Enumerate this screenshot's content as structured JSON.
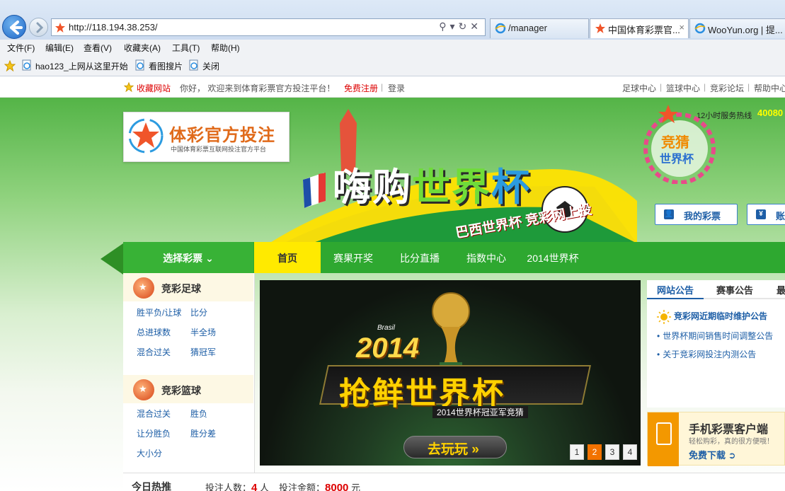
{
  "browser": {
    "address_url": "http://118.194.38.253/",
    "tabs": [
      {
        "label": "/manager"
      },
      {
        "label": "中国体育彩票官...",
        "close": "×"
      },
      {
        "label": "WooYun.org | 提..."
      }
    ],
    "menu": [
      "文件(F)",
      "编辑(E)",
      "查看(V)",
      "收藏夹(A)",
      "工具(T)",
      "帮助(H)"
    ],
    "favorites": [
      "hao123_上网从这里开始",
      "看图搜片",
      "关闭"
    ]
  },
  "topbar": {
    "bookmark": "收藏网站",
    "welcome": "你好， 欢迎来到体育彩票官方投注平台！",
    "register": "免费注册",
    "login": "登录",
    "links": [
      "足球中心",
      "篮球中心",
      "竞彩论坛",
      "帮助中心"
    ]
  },
  "logo": {
    "title": "体彩官方投注",
    "subtitle": "中国体育彩票互联网投注官方平台"
  },
  "banner": {
    "slogan": "巴西世界杯 竞彩网上投",
    "main_a": "嗨购",
    "main_b": "世界",
    "main_c": "杯"
  },
  "hotline": {
    "label": "12小时服务热线",
    "number": "40080"
  },
  "account": {
    "my_tickets": "我的彩票",
    "account": "账",
    "account_icon": "¥"
  },
  "nav": {
    "select": "选择彩票 ⌄",
    "tabs": [
      "首页",
      "赛果开奖",
      "比分直播",
      "指数中心",
      "2014世界杯"
    ]
  },
  "sidebar": {
    "football": {
      "title": "竞彩足球",
      "links": [
        "胜平负/让球",
        "比分",
        "总进球数",
        "半全场",
        "混合过关",
        "猜冠军"
      ]
    },
    "basketball": {
      "title": "竞彩篮球",
      "links": [
        "混合过关",
        "胜负",
        "让分胜负",
        "胜分差",
        "大小分"
      ]
    }
  },
  "carousel": {
    "brasil": "Brasil",
    "year": "2014",
    "headline": "抢鲜世界杯",
    "sub": "2014世界杯冠亚军竞猜",
    "play": "去玩玩 »",
    "pages": [
      "1",
      "2",
      "3",
      "4"
    ],
    "active_page": "2"
  },
  "announce": {
    "tabs": [
      "网站公告",
      "赛事公告",
      "最"
    ],
    "items": [
      "竞彩网近期临时维护公告",
      "世界杯期间销售时间调整公告",
      "关于竞彩网投注内测公告"
    ]
  },
  "mobile": {
    "title": "手机彩票客户端",
    "sub": "轻松购彩，真的很方便哦！",
    "download": "免费下载 ➲"
  },
  "hot": {
    "title": "今日热推",
    "bettors_label": "投注人数：",
    "bettors_value": "4",
    "bettors_unit": "人",
    "amount_label": "投注金额：",
    "amount_value": "8000",
    "amount_unit": "元"
  }
}
